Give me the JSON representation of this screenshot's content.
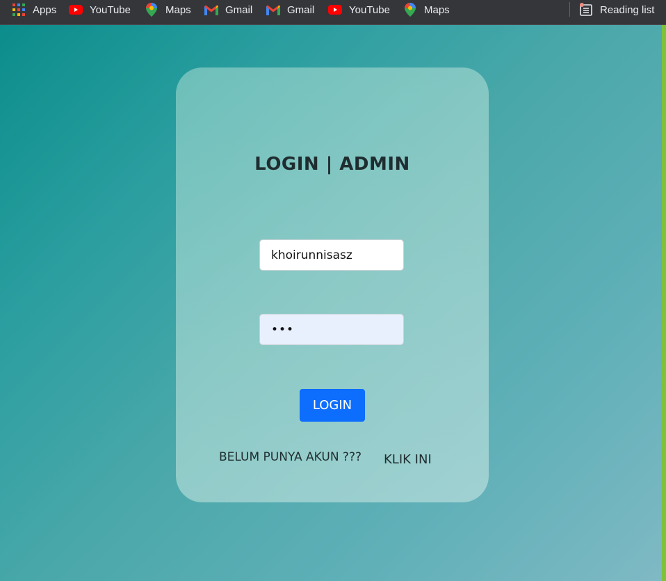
{
  "bookmarks": {
    "items": [
      {
        "label": "Apps",
        "icon": "apps-grid-icon"
      },
      {
        "label": "YouTube",
        "icon": "youtube-icon"
      },
      {
        "label": "Maps",
        "icon": "maps-pin-icon"
      },
      {
        "label": "Gmail",
        "icon": "gmail-icon"
      },
      {
        "label": "Gmail",
        "icon": "gmail-icon"
      },
      {
        "label": "YouTube",
        "icon": "youtube-icon"
      },
      {
        "label": "Maps",
        "icon": "maps-pin-icon"
      }
    ],
    "reading_list": {
      "label": "Reading list",
      "icon": "reading-list-icon"
    }
  },
  "login": {
    "title": "LOGIN | ADMIN",
    "username_value": "khoirunnisasz",
    "password_value": "•••",
    "button_label": "LOGIN",
    "signup_text": "BELUM PUNYA AKUN ???",
    "signup_link": "KLIK INI"
  },
  "colors": {
    "button": "#0d6efd",
    "bookmark_bar": "#35363a",
    "background_start": "#0b8d8b",
    "background_end": "#7fb9c4"
  }
}
